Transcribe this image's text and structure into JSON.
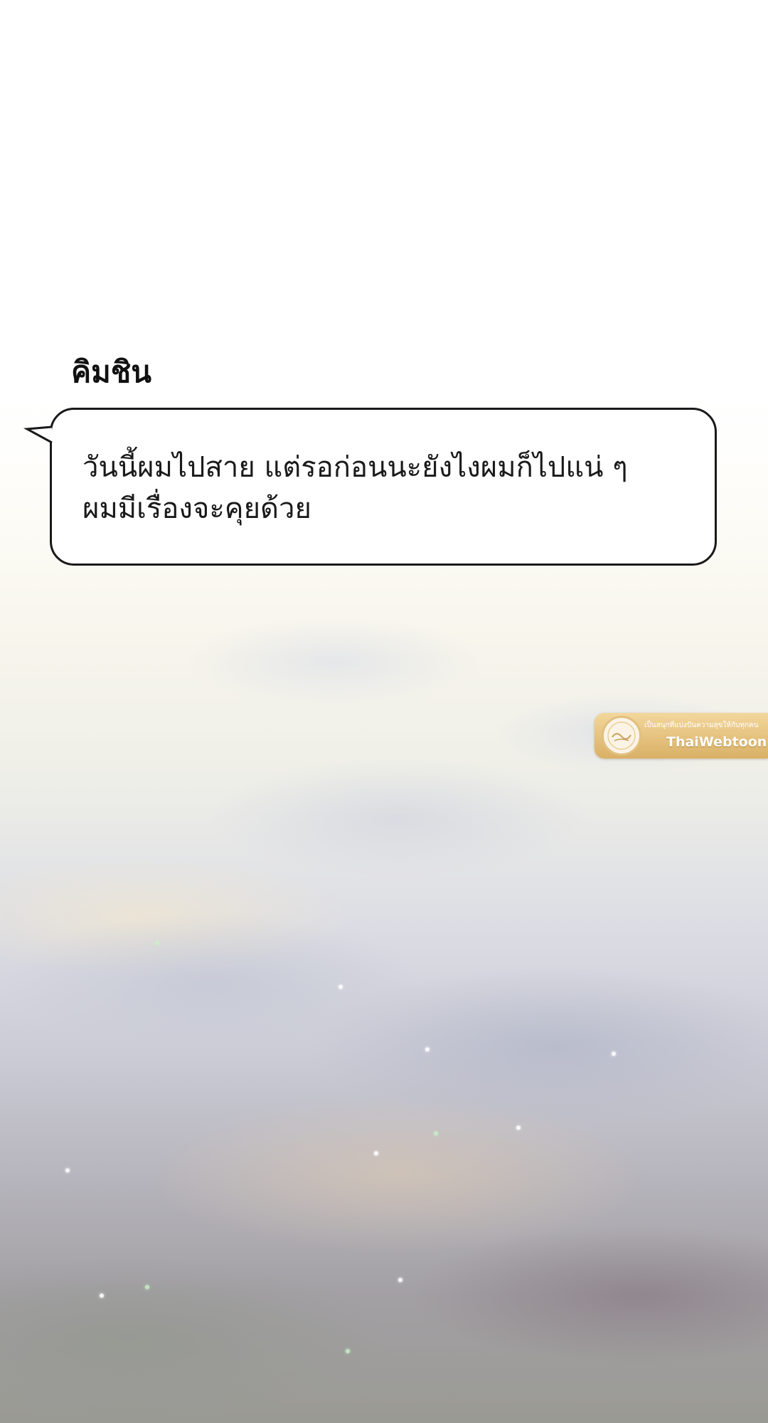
{
  "dialogue": {
    "speaker": "คิมชิน",
    "lines": [
      "วันนี้ผมไปสาย แต่รอก่อนนะยังไงผมก็ไปแน่ ๆ",
      "ผมมีเรื่องจะคุยด้วย"
    ]
  },
  "watermark": {
    "tagline": "เป็นสนุกที่แบ่งปันความสุขให้กับทุกคน",
    "brand": "ThaiWebtoon",
    "seal_text": "ThaiWebtoon",
    "colors": {
      "badge": "#dcb46a",
      "seal": "#fbf4e6"
    }
  },
  "colors": {
    "bubble_border": "#1a1a1a",
    "bubble_fill": "#ffffff",
    "text": "#1a1a1a"
  }
}
